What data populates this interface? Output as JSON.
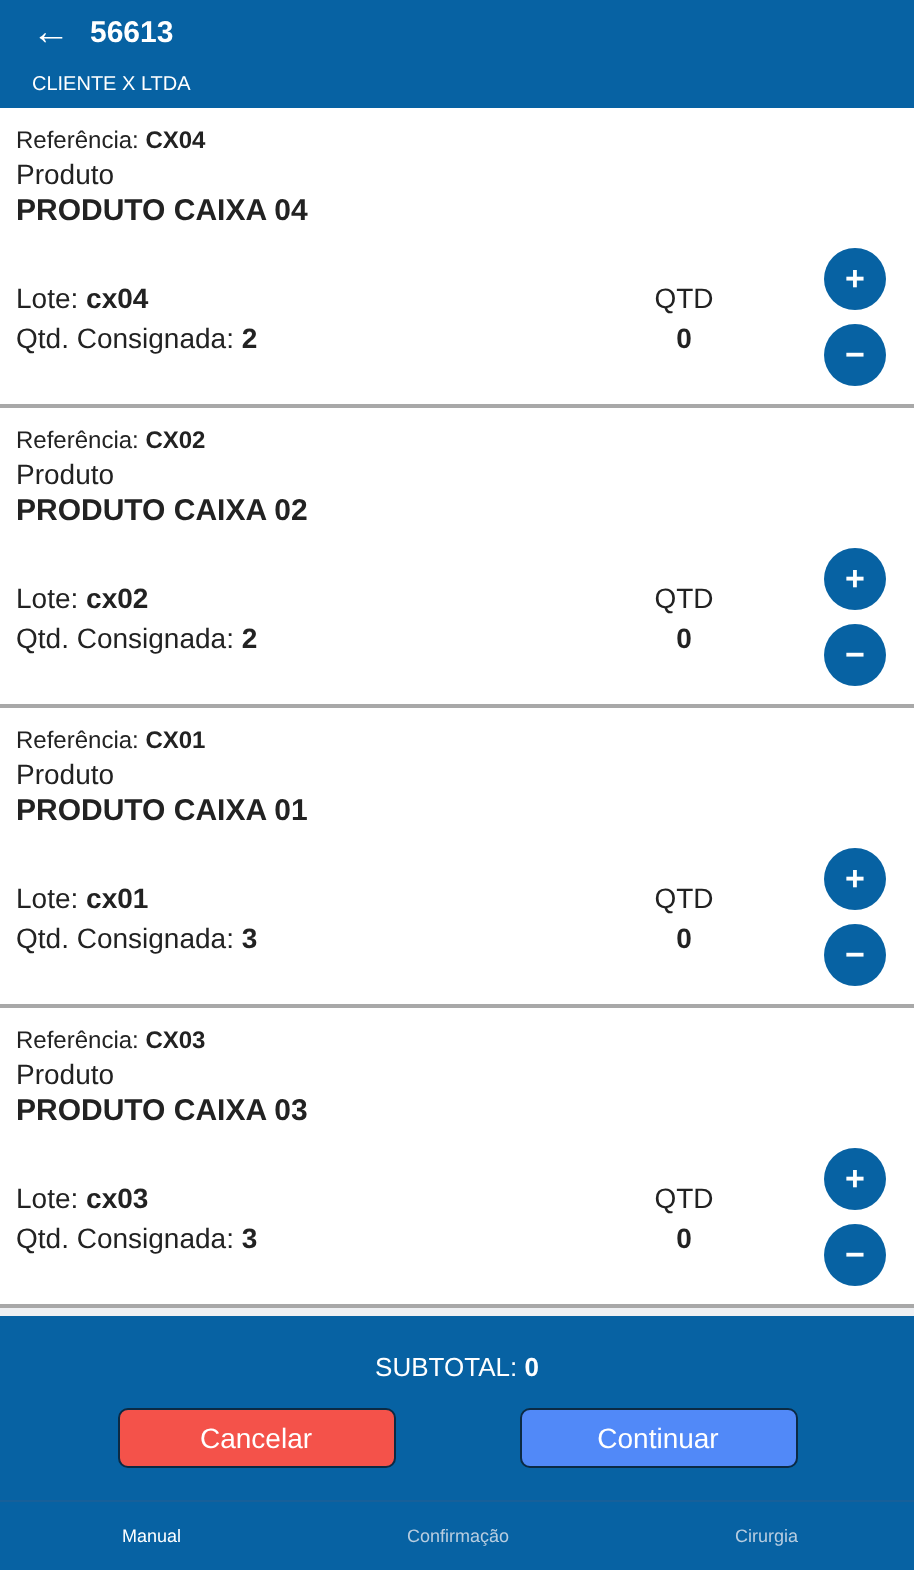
{
  "header": {
    "back_icon": "←",
    "title": "56613",
    "subtitle": "CLIENTE X LTDA"
  },
  "items": [
    {
      "reference": "Referência: **CX04**",
      "product_label": "Produto",
      "product_name": "PRODUTO CAIXA 04",
      "lot": "Lote: **cx04**",
      "consigned": "Qtd. Consignada: **2**",
      "qty_label": "QTD",
      "qty": "0",
      "plus": "+",
      "minus": "−"
    },
    {
      "reference": "Referência: **CX02**",
      "product_label": "Produto",
      "product_name": "PRODUTO CAIXA 02",
      "lot": "Lote: **cx02**",
      "consigned": "Qtd. Consignada: **2**",
      "qty_label": "QTD",
      "qty": "0",
      "plus": "+",
      "minus": "−"
    },
    {
      "reference": "Referência: **CX01**",
      "product_label": "Produto",
      "product_name": "PRODUTO CAIXA 01",
      "lot": "Lote: **cx01**",
      "consigned": "Qtd. Consignada: **3**",
      "qty_label": "QTD",
      "qty": "0",
      "plus": "+",
      "minus": "−"
    },
    {
      "reference": "Referência: **CX03**",
      "product_label": "Produto",
      "product_name": "PRODUTO CAIXA 03",
      "lot": "Lote: **cx03**",
      "consigned": "Qtd. Consignada: **3**",
      "qty_label": "QTD",
      "qty": "0",
      "plus": "+",
      "minus": "−"
    }
  ],
  "footer": {
    "subtotal": "SUBTOTAL: **0**",
    "buttons": [
      {
        "label": "Cancelar",
        "kind": "cancel"
      },
      {
        "label": "Continuar",
        "kind": "continue"
      }
    ]
  },
  "tabs": [
    {
      "label": "Manual",
      "selected": true
    },
    {
      "label": "Confirmação",
      "selected": false
    },
    {
      "label": "Cirurgia",
      "selected": false
    }
  ]
}
